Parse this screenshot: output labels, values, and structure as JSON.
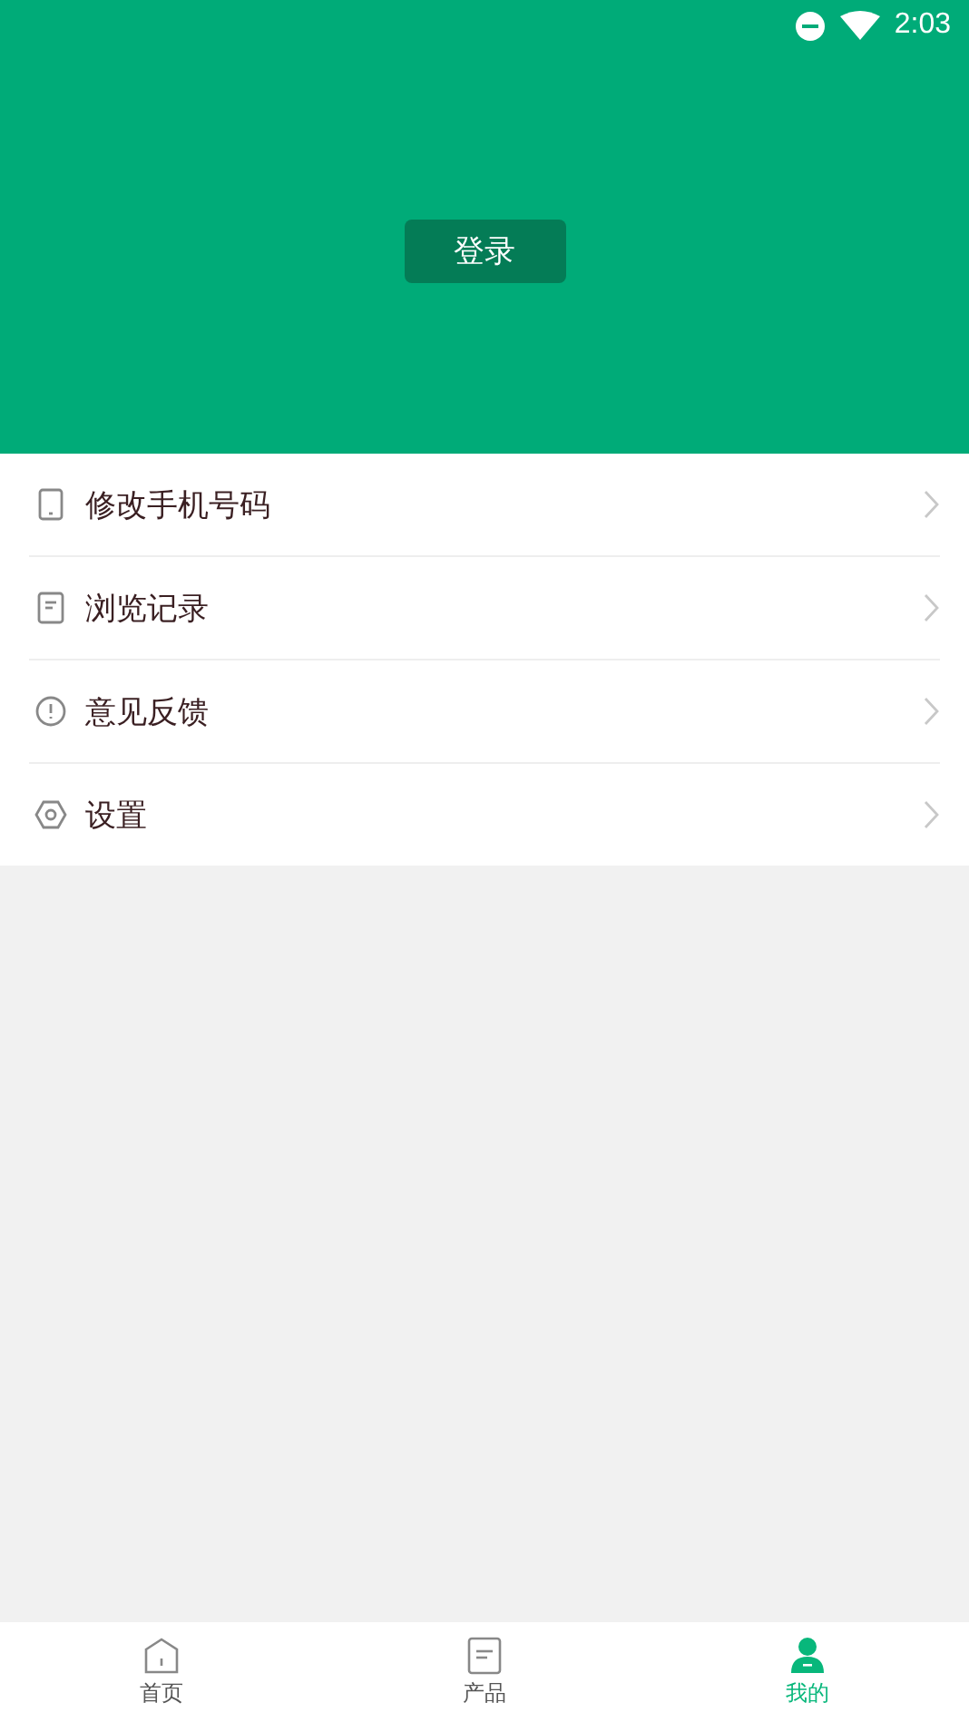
{
  "status_bar": {
    "time": "2:03"
  },
  "header": {
    "login_button": "登录"
  },
  "menu": [
    {
      "kind": "phone",
      "label": "修改手机号码"
    },
    {
      "kind": "document",
      "label": "浏览记录"
    },
    {
      "kind": "alert",
      "label": "意见反馈"
    },
    {
      "kind": "settings",
      "label": "设置"
    }
  ],
  "tab_bar": [
    {
      "kind": "home",
      "label": "首页",
      "selected": false
    },
    {
      "kind": "document",
      "label": "产品",
      "selected": false
    },
    {
      "kind": "person",
      "label": "我的",
      "selected": true
    }
  ]
}
